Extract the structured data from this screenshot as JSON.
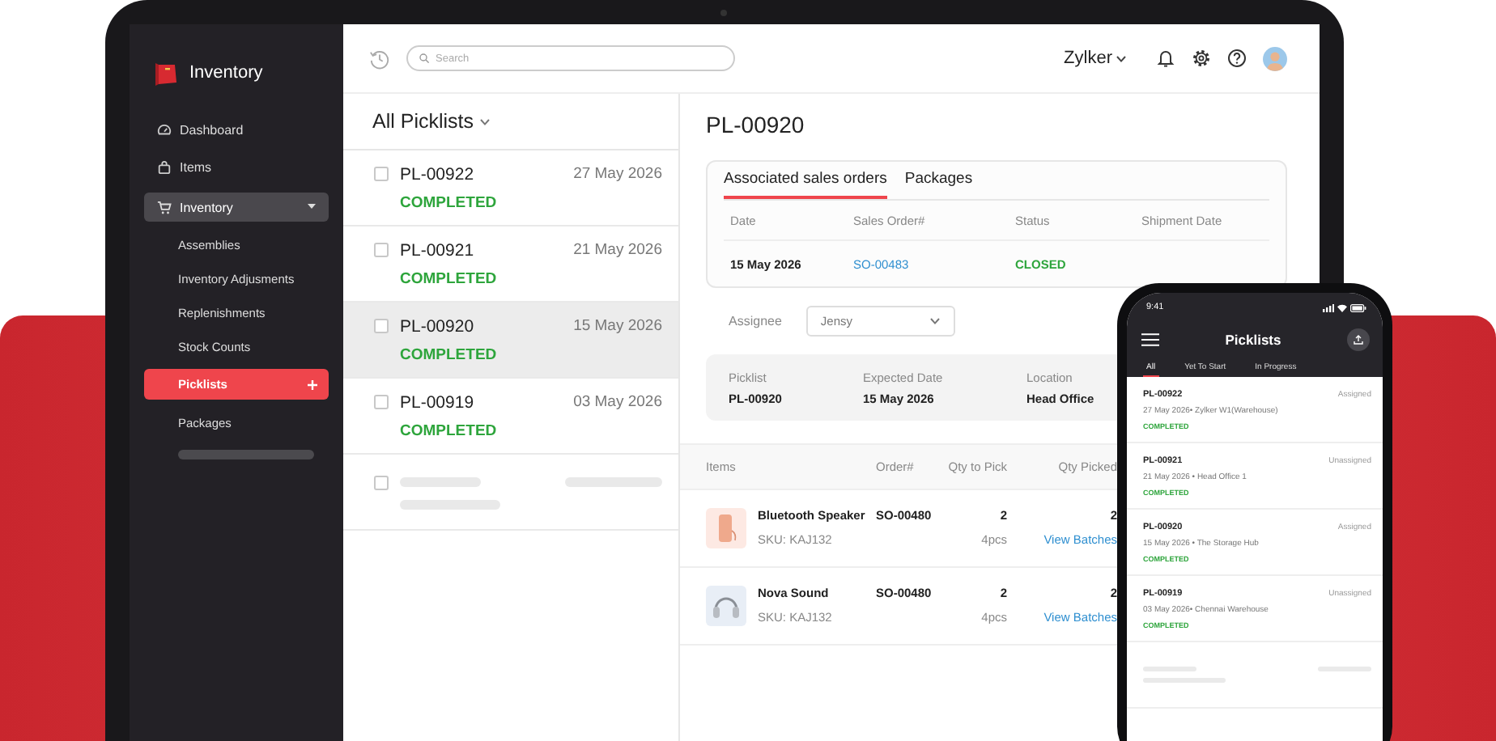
{
  "sidebar": {
    "app_name": "Inventory",
    "items": [
      {
        "label": "Dashboard",
        "expanded": false
      },
      {
        "label": "Items",
        "expanded": false
      },
      {
        "label": "Inventory",
        "expanded": true,
        "children": [
          {
            "kind": "link",
            "label": "Assemblies",
            "selected": false
          },
          {
            "kind": "link",
            "label": "Inventory Adjusments",
            "selected": false
          },
          {
            "kind": "link",
            "label": "Replenishments",
            "selected": false
          },
          {
            "kind": "link",
            "label": "Stock Counts",
            "selected": false
          },
          {
            "kind": "link",
            "label": "Picklists",
            "selected": true
          },
          {
            "kind": "link",
            "label": "Packages",
            "selected": false
          },
          {
            "kind": "placeholder"
          }
        ]
      }
    ]
  },
  "topbar": {
    "search": {
      "placeholder": "Search"
    },
    "organization": "Zylker"
  },
  "picklists": {
    "title": "All Picklists",
    "rows": [
      {
        "kind": "picklist",
        "number": "PL-00922",
        "date": "27 May 2026",
        "status": "COMPLETED",
        "selected": false,
        "checked": false
      },
      {
        "kind": "picklist",
        "number": "PL-00921",
        "date": "21 May 2026",
        "status": "COMPLETED",
        "selected": false,
        "checked": false
      },
      {
        "kind": "picklist",
        "number": "PL-00920",
        "date": "15 May 2026",
        "status": "COMPLETED",
        "selected": true,
        "checked": false
      },
      {
        "kind": "picklist",
        "number": "PL-00919",
        "date": "03 May 2026",
        "status": "COMPLETED",
        "selected": false,
        "checked": false
      },
      {
        "kind": "placeholder",
        "checked": false
      }
    ]
  },
  "detail": {
    "title": "PL-00920",
    "tabs": [
      {
        "label": "Associated sales orders",
        "selected": true
      },
      {
        "label": "Packages",
        "selected": false
      }
    ],
    "sales_orders": {
      "columns": [
        "Date",
        "Sales Order#",
        "Status",
        "Shipment Date"
      ],
      "rows": [
        {
          "date": "15 May 2026",
          "sales_order": "SO-00483",
          "status": "CLOSED"
        }
      ]
    },
    "assignee": {
      "label": "Assignee",
      "value": "Jensy"
    },
    "info": [
      {
        "label": "Picklist",
        "value": "PL-00920"
      },
      {
        "label": "Expected Date",
        "value": "15 May 2026"
      },
      {
        "label": "Location",
        "value": "Head Office"
      }
    ],
    "items": {
      "columns": [
        "Items",
        "Order#",
        "Qty to Pick",
        "Qty Picked"
      ],
      "rows": [
        {
          "kind": "speaker",
          "name": "Bluetooth Speaker",
          "sku": "SKU: KAJ132",
          "order": "SO-00480",
          "qty_to_pick": "2",
          "unit": "4pcs",
          "qty_picked": "2",
          "link": "View Batches"
        },
        {
          "kind": "headphones",
          "name": "Nova Sound",
          "sku": "SKU: KAJ132",
          "order": "SO-00480",
          "qty_to_pick": "2",
          "unit": "4pcs",
          "qty_picked": "2",
          "link": "View Batches"
        }
      ]
    }
  },
  "phone": {
    "time": "9:41",
    "title": "Picklists",
    "tabs": [
      {
        "label": "All",
        "selected": true
      },
      {
        "label": "Yet To Start",
        "selected": false
      },
      {
        "label": "In Progress",
        "selected": false
      }
    ],
    "items": [
      {
        "kind": "picklist",
        "number": "PL-00922",
        "assignment": "Assigned",
        "meta": "27 May 2026• Zylker W1(Warehouse)",
        "status": "COMPLETED"
      },
      {
        "kind": "picklist",
        "number": "PL-00921",
        "assignment": "Unassigned",
        "meta": "21 May 2026 • Head Office 1",
        "status": "COMPLETED"
      },
      {
        "kind": "picklist",
        "number": "PL-00920",
        "assignment": "Assigned",
        "meta": "15 May 2026 • The Storage Hub",
        "status": "COMPLETED"
      },
      {
        "kind": "picklist",
        "number": "PL-00919",
        "assignment": "Unassigned",
        "meta": "03 May 2026• Chennai Warehouse",
        "status": "COMPLETED"
      },
      {
        "kind": "placeholder"
      }
    ]
  }
}
